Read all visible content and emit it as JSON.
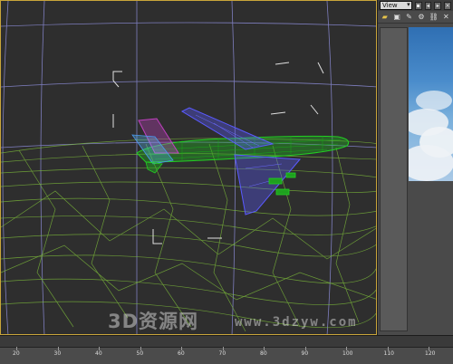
{
  "panel": {
    "view_select": "View",
    "icons": [
      "toggle-icon",
      "nav-back-icon",
      "nav-forward-icon",
      "close-icon"
    ],
    "toolbar_icons": [
      "folder-icon",
      "lock-icon",
      "brush-icon",
      "gear-icon",
      "link-icon",
      "close-icon"
    ]
  },
  "watermark": {
    "brand": "3D资源网",
    "url": "www.3dzyw.com"
  },
  "timeline": {
    "labels": [
      "20",
      "30",
      "40",
      "50",
      "60",
      "70",
      "80",
      "90",
      "100",
      "110",
      "120"
    ]
  },
  "colors": {
    "grid": "#9a9aff",
    "terrain_wire": "#7fbf3a",
    "plane_body": "#20c020",
    "plane_wing": "#5a5aff",
    "plane_tail": "#c040c0",
    "viewport_border": "#c9a53a"
  }
}
